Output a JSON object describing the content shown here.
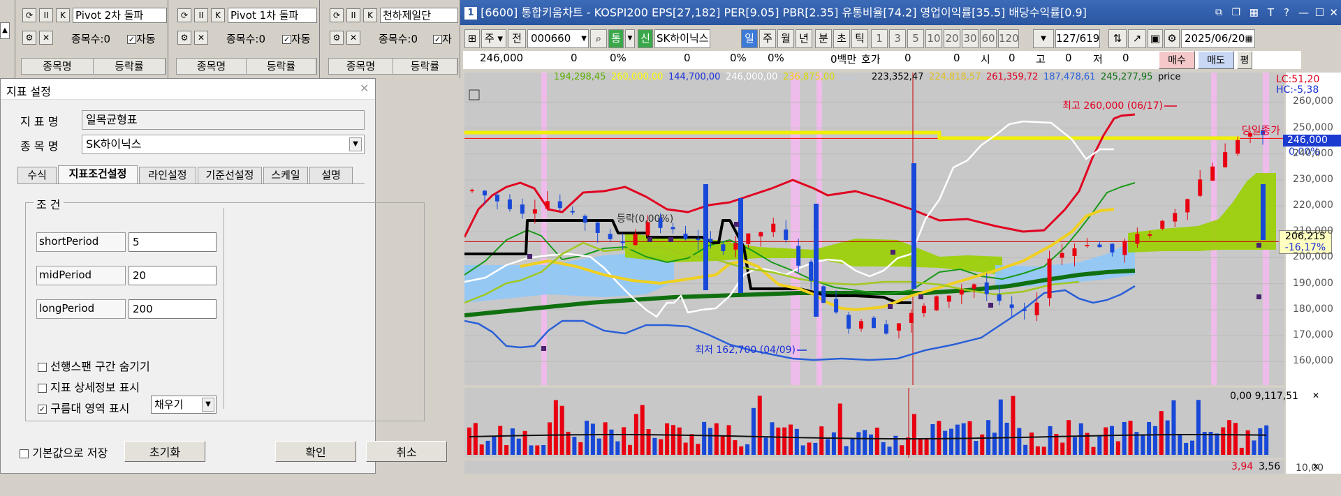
{
  "mini_panels": [
    {
      "name": "Pivot 2차 돌파",
      "count_label": "종목수:0",
      "auto_label": "자동",
      "col1": "종목명",
      "col2": "등락률"
    },
    {
      "name": "Pivot 1차 돌파",
      "count_label": "종목수:0",
      "auto_label": "자동",
      "col1": "종목명",
      "col2": "등락률"
    },
    {
      "name": "천하제일단",
      "count_label": "종목수:0",
      "auto_label": "자",
      "col1": "종목명",
      "col2": "등락률"
    }
  ],
  "mini_icons": {
    "ii": "II",
    "k": "K"
  },
  "dialog": {
    "title": "지표 설정",
    "name_label": "지 표 명",
    "name_value": "일목균형표",
    "stock_label": "종 목 명",
    "stock_value": "SK하이닉스",
    "tabs": [
      "수식",
      "지표조건설정",
      "라인설정",
      "기준선설정",
      "스케일",
      "설명"
    ],
    "group_label": "조 건",
    "params": [
      {
        "label": "shortPeriod",
        "value": "5"
      },
      {
        "label": "midPeriod",
        "value": "20"
      },
      {
        "label": "longPeriod",
        "value": "200"
      }
    ],
    "options": [
      {
        "label": "선행스팬 구간 숨기기",
        "checked": false
      },
      {
        "label": "지표 상세정보 표시",
        "checked": false
      },
      {
        "label": "구름대 영역 표시",
        "checked": true
      }
    ],
    "fill_select": "채우기",
    "save_default": "기본값으로 저장",
    "reset": "초기화",
    "ok": "확인",
    "cancel": "취소"
  },
  "chart_window": {
    "title": "[6600] 통합키움차트 - KOSPI200 EPS[27,182] PER[9.05] PBR[2.35] 유통비율[74.2] 영업이익률[35.5] 배당수익률[0.9]",
    "win_num": "1",
    "toolbar": {
      "t1": "주",
      "t2": "전",
      "code": "000660",
      "t3": "통",
      "t4": "신",
      "stock": "SK하이닉스",
      "periods": [
        "일",
        "주",
        "월",
        "년",
        "분",
        "초",
        "틱"
      ],
      "nums": [
        "1",
        "3",
        "5",
        "10",
        "20",
        "30",
        "60",
        "120"
      ],
      "count": "127/619",
      "date": "2025/06/20"
    },
    "quote": {
      "price": "246,000",
      "v1": "0",
      "p1": "0%",
      "v2": "0",
      "p2": "0%",
      "p3": "0%",
      "amt": "0백만",
      "hoga": "호가",
      "h1": "0",
      "h2": "0",
      "si": "시",
      "si_v": "0",
      "go": "고",
      "go_v": "0",
      "jeo": "저",
      "jeo_v": "0",
      "buy": "매수",
      "sell": "매도",
      "pyeong": "평"
    },
    "legend": [
      {
        "text": "194,298,45",
        "color": "#5cb000"
      },
      {
        "text": "260,000,00",
        "color": "#ffff00"
      },
      {
        "text": "144,700,00",
        "color": "#1a2ed8"
      },
      {
        "text": "246,000,00",
        "color": "#ffffff"
      },
      {
        "text": "236,875,00",
        "color": "#d8d800"
      },
      {
        "text": "-,-,-",
        "color": "#b0d0ff"
      },
      {
        "text": "223,352,47",
        "color": "#000000"
      },
      {
        "text": "224,818,57",
        "color": "#e0c020"
      },
      {
        "text": "261,359,72",
        "color": "#e00020"
      },
      {
        "text": "187,478,61",
        "color": "#2a60d8"
      },
      {
        "text": "245,277,95",
        "color": "#107010"
      },
      {
        "text": "price",
        "color": "#000000"
      }
    ],
    "lc": "LC:51,20",
    "hc": "HC:-5,38",
    "annotations": {
      "high": "최고 260,000 (06/17)",
      "low": "최저 162,700 (04/09)",
      "close_label": "당일종가",
      "drop": "등락(0,00%)"
    },
    "price_tag": "246,000",
    "pct_tag": "0,00%",
    "cross_tag": "206,215",
    "cross_pct": "-16,17%",
    "volume_info": "0,00 9,117,51",
    "bottom_left": "3,94",
    "bottom_right": "3,56",
    "bottom_axis": "10,00",
    "colors": {
      "up": "#e80010",
      "down": "#1848d8",
      "cloud": "#90c800",
      "bg": "#c8c8c8"
    }
  },
  "chart_data": {
    "type": "line",
    "y_ticks": [
      160000,
      170000,
      180000,
      190000,
      200000,
      210000,
      220000,
      230000,
      240000,
      250000,
      260000
    ],
    "y_tick_labels": [
      "160,000",
      "170,000",
      "180,000",
      "190,000",
      "200,000",
      "210,000",
      "220,000",
      "230,000",
      "240,000",
      "250,000",
      "260,000"
    ],
    "ylim": [
      152000,
      266000
    ],
    "close_price": 246000,
    "high": 260000,
    "low": 162700,
    "current_crosshair": 206215
  }
}
